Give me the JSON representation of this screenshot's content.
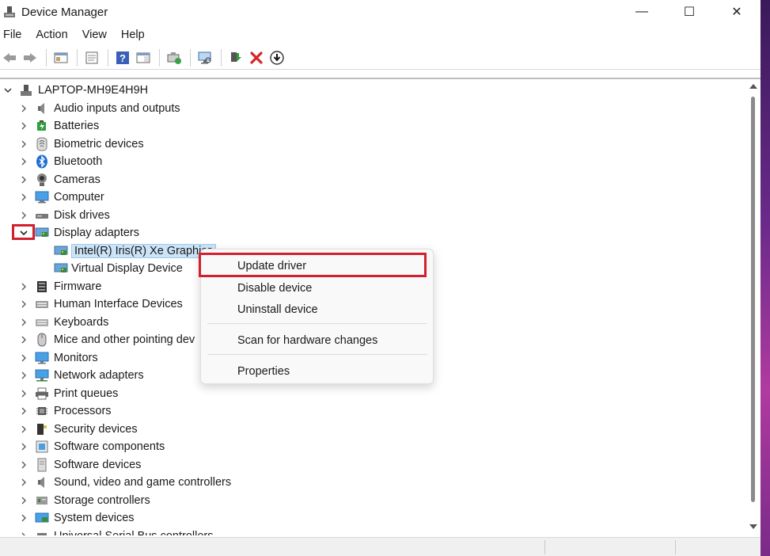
{
  "window": {
    "title": "Device Manager",
    "controls": {
      "minimize": "—",
      "maximize": "☐",
      "close": "✕"
    }
  },
  "menu": [
    "File",
    "Action",
    "View",
    "Help"
  ],
  "toolbar": {
    "buttons": [
      "back-icon",
      "forward-icon",
      "show-hide-console-tree-icon",
      "properties-icon",
      "help-icon",
      "action-pane-icon",
      "update-driver-icon",
      "scan-hardware-icon",
      "enable-device-icon",
      "uninstall-icon",
      "disable-device-icon"
    ]
  },
  "tree": {
    "root": "LAPTOP-MH9E4H9H",
    "categories": [
      "Audio inputs and outputs",
      "Batteries",
      "Biometric devices",
      "Bluetooth",
      "Cameras",
      "Computer",
      "Disk drives",
      "Display adapters",
      "Firmware",
      "Human Interface Devices",
      "Keyboards",
      "Mice and other pointing dev",
      "Monitors",
      "Network adapters",
      "Print queues",
      "Processors",
      "Security devices",
      "Software components",
      "Software devices",
      "Sound, video and game controllers",
      "Storage controllers",
      "System devices",
      "Universal Serial Bus controllers"
    ],
    "display_children": [
      "Intel(R) Iris(R) Xe Graphics",
      "Virtual Display Device"
    ]
  },
  "context_menu": {
    "items": [
      "Update driver",
      "Disable device",
      "Uninstall device",
      "Scan for hardware changes",
      "Properties"
    ]
  },
  "colors": {
    "highlight": "#d2202e",
    "selection": "#cce4f7",
    "desktop": "#6a2a8a"
  }
}
